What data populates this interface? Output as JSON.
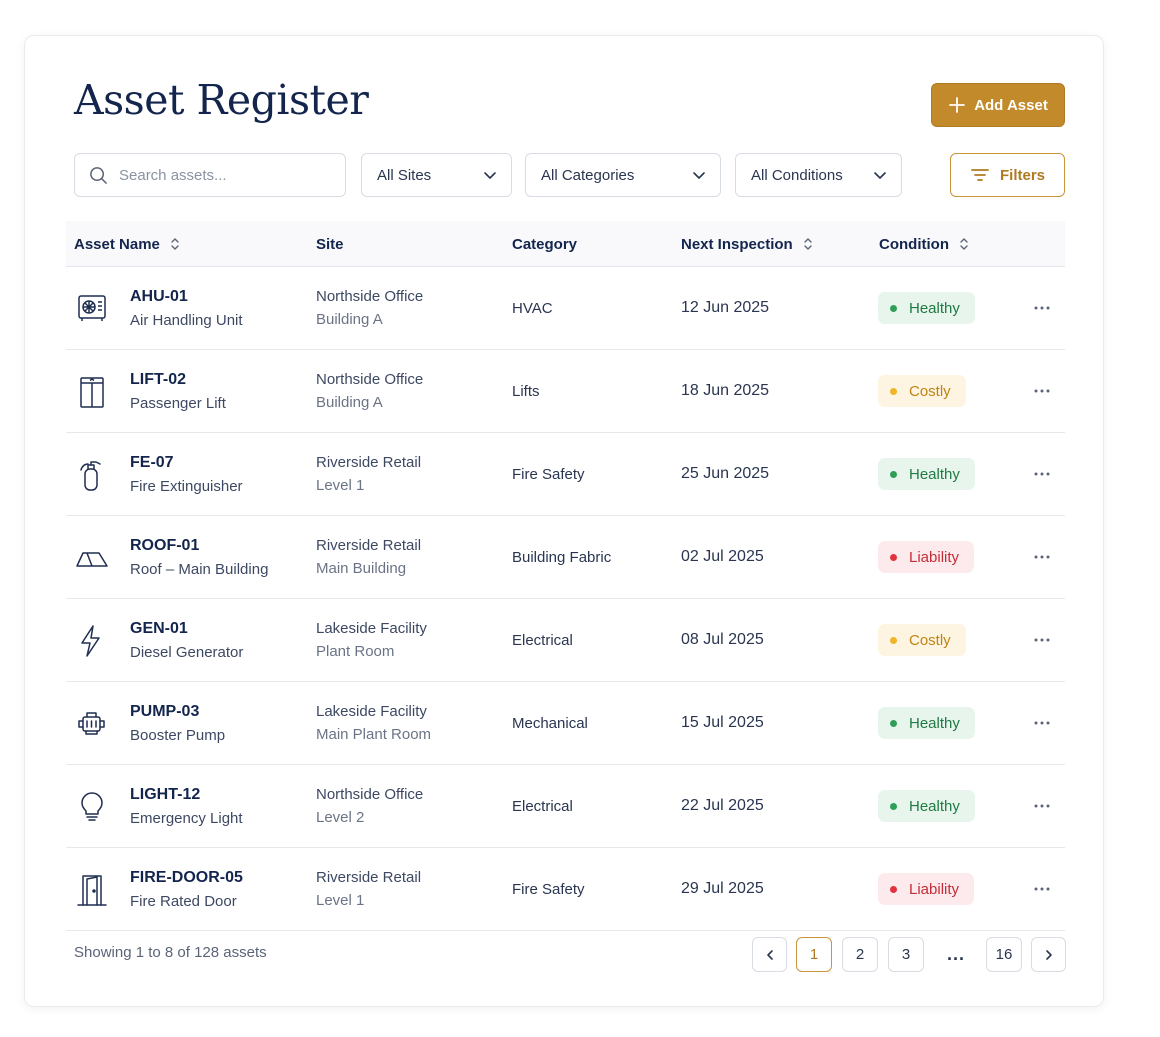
{
  "header": {
    "title": "Asset Register",
    "add_label": "Add Asset"
  },
  "toolbar": {
    "search_placeholder": "Search assets...",
    "sites": "All Sites",
    "categories": "All Categories",
    "conditions": "All Conditions",
    "filters_label": "Filters"
  },
  "table": {
    "columns": {
      "asset": "Asset Name",
      "site": "Site",
      "category": "Category",
      "next_inspection": "Next Inspection",
      "condition": "Condition"
    },
    "rows": [
      {
        "id": "AHU-01",
        "name": "Air Handling Unit",
        "icon": "air-handler-icon",
        "site": "Northside Office",
        "location": "Building A",
        "category": "HVAC",
        "next_inspection": "12 Jun 2025",
        "condition": "Healthy",
        "tone": "green"
      },
      {
        "id": "LIFT-02",
        "name": "Passenger Lift",
        "icon": "lift-icon",
        "site": "Northside Office",
        "location": "Building A",
        "category": "Lifts",
        "next_inspection": "18 Jun 2025",
        "condition": "Costly",
        "tone": "amber"
      },
      {
        "id": "FE-07",
        "name": "Fire Extinguisher",
        "icon": "fire-extinguisher-icon",
        "site": "Riverside Retail",
        "location": "Level 1",
        "category": "Fire Safety",
        "next_inspection": "25 Jun 2025",
        "condition": "Healthy",
        "tone": "green"
      },
      {
        "id": "ROOF-01",
        "name": "Roof – Main Building",
        "icon": "roof-icon",
        "site": "Riverside Retail",
        "location": "Main Building",
        "category": "Building Fabric",
        "next_inspection": "02 Jul 2025",
        "condition": "Liability",
        "tone": "red"
      },
      {
        "id": "GEN-01",
        "name": "Diesel Generator",
        "icon": "lightning-icon",
        "site": "Lakeside Facility",
        "location": "Plant Room",
        "category": "Electrical",
        "next_inspection": "08 Jul 2025",
        "condition": "Costly",
        "tone": "amber"
      },
      {
        "id": "PUMP-03",
        "name": "Booster Pump",
        "icon": "pump-icon",
        "site": "Lakeside Facility",
        "location": "Main Plant Room",
        "category": "Mechanical",
        "next_inspection": "15 Jul 2025",
        "condition": "Healthy",
        "tone": "green"
      },
      {
        "id": "LIGHT-12",
        "name": "Emergency Light",
        "icon": "light-bulb-icon",
        "site": "Northside Office",
        "location": "Level 2",
        "category": "Electrical",
        "next_inspection": "22 Jul 2025",
        "condition": "Healthy",
        "tone": "green"
      },
      {
        "id": "FIRE-DOOR-05",
        "name": "Fire Rated Door",
        "icon": "door-icon",
        "site": "Riverside Retail",
        "location": "Level 1",
        "category": "Fire Safety",
        "next_inspection": "29 Jul 2025",
        "condition": "Liability",
        "tone": "red"
      }
    ]
  },
  "footer": {
    "summary": "Showing 1 to 8 of 128 assets",
    "pages": [
      "1",
      "2",
      "3",
      "...",
      "16"
    ],
    "current_page": "1"
  },
  "colors": {
    "accent": "#c28a2a",
    "navy": "#13254d",
    "green": "#2f9e57",
    "green_bg": "#e8f5ec",
    "amber": "#f0b429",
    "amber_bg": "#fdf5e1",
    "red": "#e0333f",
    "red_bg": "#fdeaec"
  }
}
